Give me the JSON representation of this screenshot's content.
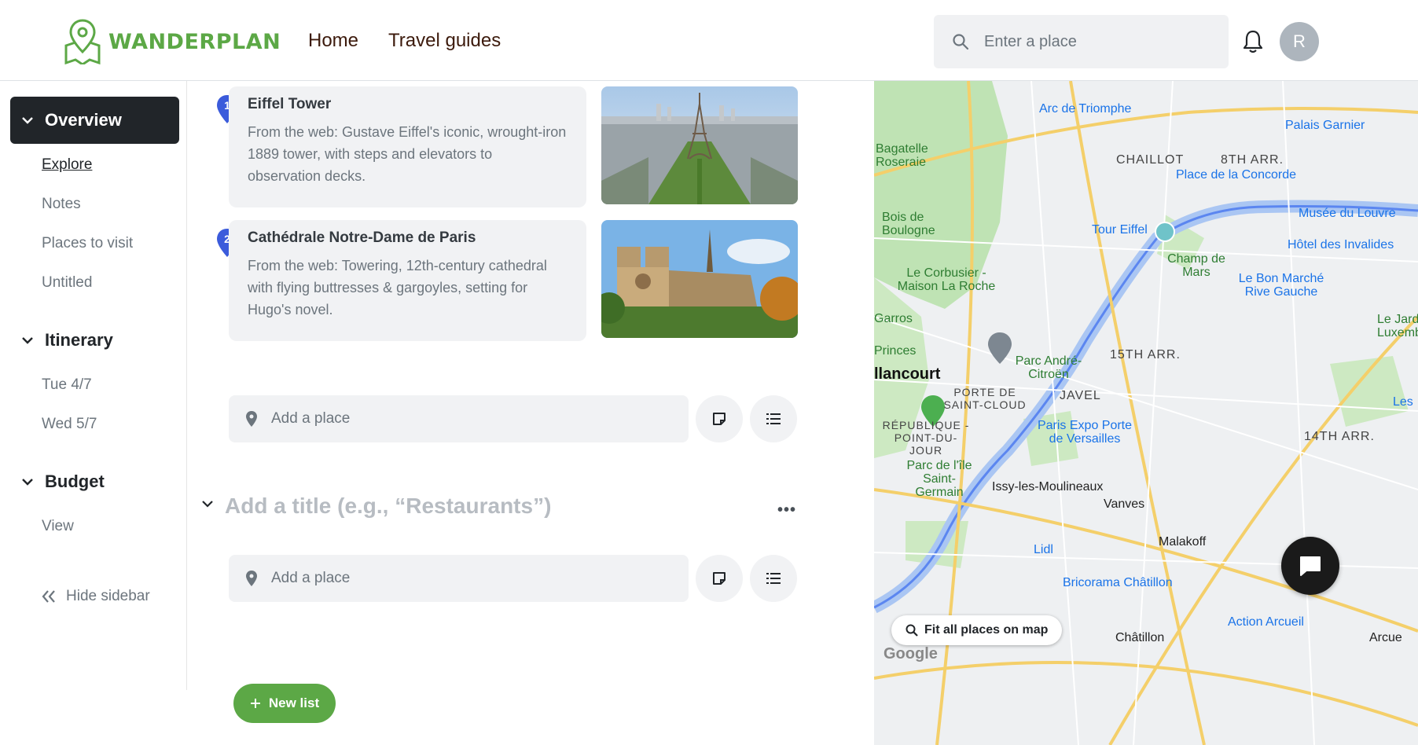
{
  "header": {
    "brand": "WANDERPLAN",
    "nav": [
      "Home",
      "Travel guides"
    ],
    "search_placeholder": "Enter a place",
    "avatar_initial": "R"
  },
  "sidebar": {
    "sections": [
      {
        "label": "Overview",
        "items": [
          "Explore",
          "Notes",
          "Places to visit",
          "Untitled"
        ]
      },
      {
        "label": "Itinerary",
        "items": [
          "Tue 4/7",
          "Wed 5/7"
        ]
      },
      {
        "label": "Budget",
        "items": [
          "View"
        ]
      }
    ],
    "hide_label": "Hide sidebar"
  },
  "places": [
    {
      "index": "1",
      "name": "Eiffel Tower",
      "description": "From the web: Gustave Eiffel's iconic, wrought-iron 1889 tower, with steps and elevators to observation decks."
    },
    {
      "index": "2",
      "name": "Cathédrale Notre-Dame de Paris",
      "description": "From the web: Towering, 12th-century cathedral with flying buttresses & gargoyles, setting for Hugo's novel."
    }
  ],
  "add_place_label": "Add a place",
  "list_title_placeholder": "Add a title (e.g., “Restaurants”)",
  "more_label": "•••",
  "new_list_label": "New list",
  "map": {
    "fit_label": "Fit all places on map",
    "google_label": "Google",
    "labels": {
      "arc": "Arc de Triomphe",
      "garnier": "Palais Garnier",
      "chaillot": "CHAILLOT",
      "arr8": "8TH ARR.",
      "concorde": "Place de la Concorde",
      "bagatelle": "Bagatelle Roseraie",
      "bois": "Bois de Boulogne",
      "louvre": "Musée du Louvre",
      "eiffel": "Tour Eiffel",
      "invalides": "Hôtel des Invalides",
      "champ": "Champ de Mars",
      "bonmarche": "Le Bon Marché Rive Gauche",
      "corbusier": "Le Corbusier - Maison La Roche",
      "garros": "Garros",
      "princes": "Princes",
      "parc": "Parc André-Citroën",
      "arr15": "15TH ARR.",
      "billancourt": "llancourt",
      "javel": "JAVEL",
      "stcloud": "PORTE DE SAINT-CLOUD",
      "republique": "RÉPUBLIQUE - POINT-DU-JOUR",
      "expo": "Paris Expo Porte de Versailles",
      "arr14": "14TH ARR.",
      "parcile": "Parc de l'île Saint-Germain",
      "issy": "Issy-les-Moulineaux",
      "vanves": "Vanves",
      "malakoff": "Malakoff",
      "lidl": "Lidl",
      "brico": "Bricorama Châtillon",
      "action": "Action Arcueil",
      "chatillon": "Châtillon",
      "arcue": "Arcue",
      "jardin": "Le Jard Luxemb",
      "les": "Les"
    }
  }
}
